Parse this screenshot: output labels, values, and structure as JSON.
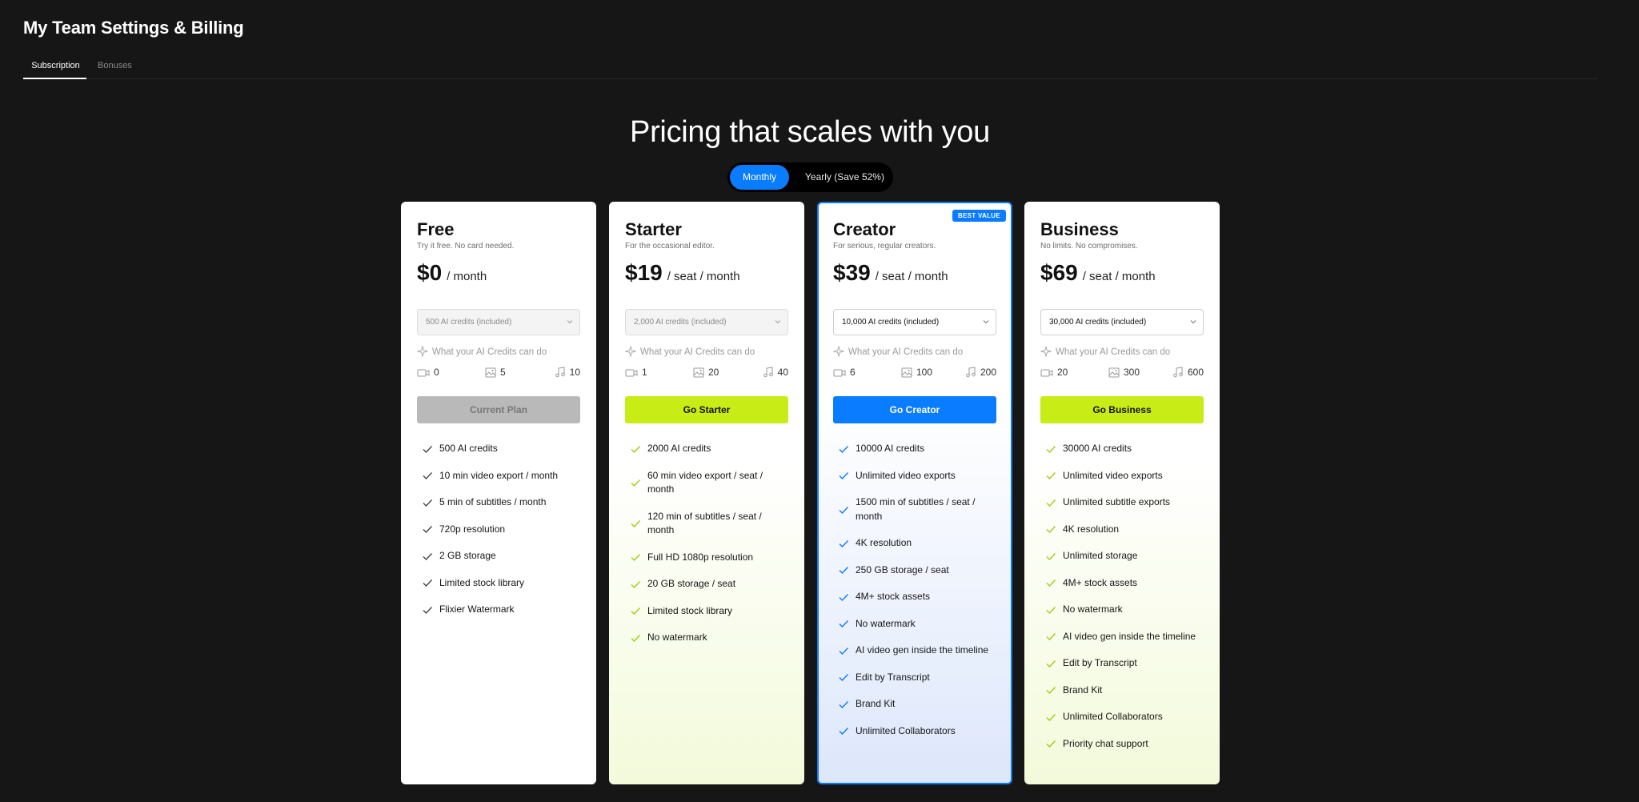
{
  "page": {
    "title": "My Team Settings & Billing"
  },
  "tabs": [
    {
      "label": "Subscription",
      "active": true
    },
    {
      "label": "Bonuses",
      "active": false
    }
  ],
  "hero": {
    "title": "Pricing that scales with you"
  },
  "billing_toggle": {
    "monthly": "Monthly",
    "yearly": "Yearly (Save 52%)",
    "selected": "Monthly"
  },
  "colors": {
    "accent_blue": "#0a7cff",
    "accent_lime": "#c8ec16",
    "background": "#161616"
  },
  "credits_hint": "What your AI Credits can do",
  "plans": [
    {
      "name": "Free",
      "desc": "Try it free. No card needed.",
      "price": "$0",
      "unit": "/ month",
      "credits": "500 AI credits (included)",
      "video": "0",
      "image": "5",
      "audio": "10",
      "cta": "Current Plan",
      "features": [
        "500 AI credits",
        "10 min video export / month",
        "5 min of subtitles / month",
        "720p resolution",
        "2 GB storage",
        "Limited stock library",
        "Flixier Watermark"
      ]
    },
    {
      "name": "Starter",
      "desc": "For the occasional editor.",
      "price": "$19",
      "unit": "/ seat / month",
      "credits": "2,000 AI credits (included)",
      "video": "1",
      "image": "20",
      "audio": "40",
      "cta": "Go Starter",
      "features": [
        "2000 AI credits",
        "60 min video export / seat / month",
        "120 min of subtitles / seat / month",
        "Full HD 1080p resolution",
        "20 GB storage / seat",
        "Limited stock library",
        "No watermark"
      ]
    },
    {
      "name": "Creator",
      "badge": "BEST VALUE",
      "desc": "For serious, regular creators.",
      "price": "$39",
      "unit": "/ seat / month",
      "credits": "10,000 AI credits (included)",
      "video": "6",
      "image": "100",
      "audio": "200",
      "cta": "Go Creator",
      "features": [
        "10000 AI credits",
        "Unlimited video exports",
        "1500 min of subtitles / seat / month",
        "4K resolution",
        "250 GB storage / seat",
        "4M+ stock assets",
        "No watermark",
        "AI video gen inside the timeline",
        "Edit by Transcript",
        "Brand Kit",
        "Unlimited Collaborators"
      ]
    },
    {
      "name": "Business",
      "desc": "No limits. No compromises.",
      "price": "$69",
      "unit": "/ seat / month",
      "credits": "30,000 AI credits (included)",
      "video": "20",
      "image": "300",
      "audio": "600",
      "cta": "Go Business",
      "features": [
        "30000 AI credits",
        "Unlimited video exports",
        "Unlimited subtitle exports",
        "4K resolution",
        "Unlimited storage",
        "4M+ stock assets",
        "No watermark",
        "AI video gen inside the timeline",
        "Edit by Transcript",
        "Brand Kit",
        "Unlimited Collaborators",
        "Priority chat support"
      ]
    }
  ]
}
